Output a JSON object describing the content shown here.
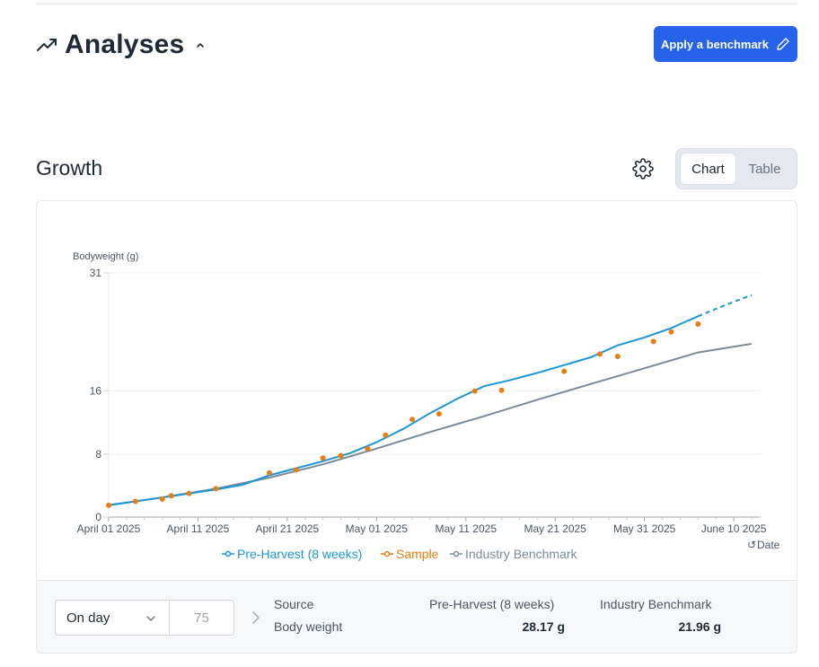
{
  "header": {
    "title": "Analyses",
    "benchmark_button": "Apply a benchmark"
  },
  "growth": {
    "title": "Growth",
    "view_tabs": [
      "Chart",
      "Table"
    ],
    "active_tab": "Chart"
  },
  "colors": {
    "primary": "#2563eb",
    "pre_harvest": "#1a96d8",
    "sample": "#e67e11",
    "benchmark": "#7a8a99"
  },
  "chart_data": {
    "type": "line",
    "ylabel": "Bodyweight (g)",
    "xlabel": "Date",
    "y_ticks": [
      0,
      8,
      16,
      31
    ],
    "ylim": [
      0,
      31
    ],
    "x_ticks": [
      "April 01 2025",
      "April 11 2025",
      "April 21 2025",
      "May 01 2025",
      "May 11 2025",
      "May 21 2025",
      "May 31 2025",
      "June 10 2025"
    ],
    "xlim_days": [
      0,
      72
    ],
    "series": [
      {
        "name": "Pre-Harvest (8 weeks)",
        "style": "line",
        "x": [
          0,
          3,
          6,
          9,
          12,
          15,
          18,
          21,
          24,
          27,
          30,
          33,
          36,
          39,
          42,
          45,
          48,
          51,
          54,
          57,
          60,
          63,
          66,
          69,
          72
        ],
        "y": [
          1.5,
          2.0,
          2.5,
          3.0,
          3.5,
          4.1,
          5.3,
          6.2,
          7.1,
          8.1,
          9.5,
          11.2,
          13.2,
          15.0,
          16.6,
          17.4,
          18.3,
          19.3,
          20.3,
          21.8,
          22.8,
          24.0,
          25.5,
          26.9,
          28.2
        ],
        "projected_from_index": 22
      },
      {
        "name": "Sample",
        "style": "points",
        "x": [
          0,
          3,
          6,
          7,
          9,
          12,
          18,
          21,
          24,
          26,
          29,
          31,
          34,
          37,
          41,
          44,
          51,
          55,
          57,
          61,
          63,
          66
        ],
        "y": [
          1.5,
          2.0,
          2.3,
          2.7,
          3.0,
          3.6,
          5.6,
          6.0,
          7.5,
          7.8,
          8.7,
          10.4,
          12.4,
          13.1,
          16.0,
          16.1,
          18.5,
          20.7,
          20.4,
          22.3,
          23.5,
          24.5
        ]
      },
      {
        "name": "Industry Benchmark",
        "style": "line",
        "x": [
          0,
          6,
          12,
          18,
          24,
          30,
          36,
          42,
          48,
          54,
          60,
          66,
          72
        ],
        "y": [
          1.5,
          2.5,
          3.6,
          5.0,
          6.7,
          8.7,
          10.8,
          12.8,
          14.9,
          16.9,
          18.9,
          20.9,
          22.0
        ]
      }
    ],
    "legend": [
      "Pre-Harvest (8 weeks)",
      "Sample",
      "Industry Benchmark"
    ],
    "legend_position": "bottom",
    "grid": true
  },
  "footer": {
    "select_value": "On day",
    "day_value": "75",
    "source_label": "Source",
    "metric_label": "Body weight",
    "col1_header": "Pre-Harvest (8 weeks)",
    "col2_header": "Industry Benchmark",
    "col1_value": "28.17 g",
    "col2_value": "21.96 g"
  }
}
